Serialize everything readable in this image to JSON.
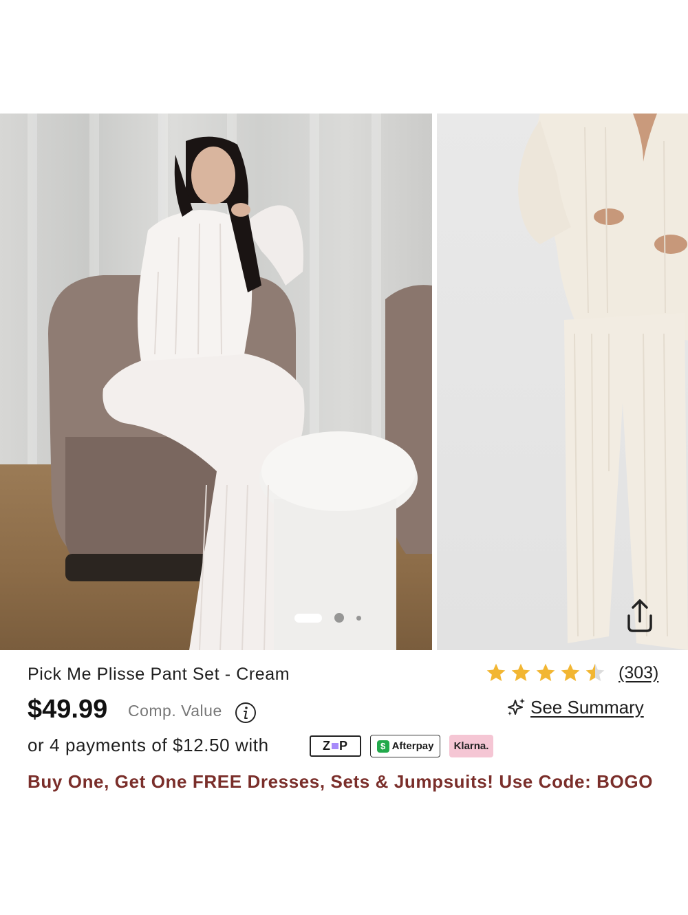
{
  "gallery": {
    "main_image_alt": "Model seated in cream pleated shirt and pants",
    "secondary_image_alt": "Cream pleated shirt and pants, front view",
    "pagination": {
      "total": 3,
      "active": 1
    }
  },
  "product": {
    "title": "Pick Me Plisse Pant Set - Cream",
    "price": "$49.99",
    "comp_value_label": "Comp. Value",
    "rating": 4.5,
    "reviews": "(303)",
    "see_summary": "See Summary"
  },
  "payments": {
    "text": "or 4 payments of $12.50 with",
    "zip_label": "ZIP",
    "afterpay_label": "Afterpay",
    "klarna_label": "Klarna."
  },
  "promo": {
    "text": "Buy One, Get One FREE Dresses, Sets & Jumpsuits! Use Code: BOGO"
  },
  "colors": {
    "star": "#f2b632",
    "promo": "#7a2e2a",
    "klarna": "#f5c6d4",
    "afterpay_icon": "#22a94b",
    "zip_accent": "#a78bfa"
  },
  "icons": {
    "share": "share-icon",
    "info": "info-icon",
    "sparkle": "sparkle-icon"
  }
}
